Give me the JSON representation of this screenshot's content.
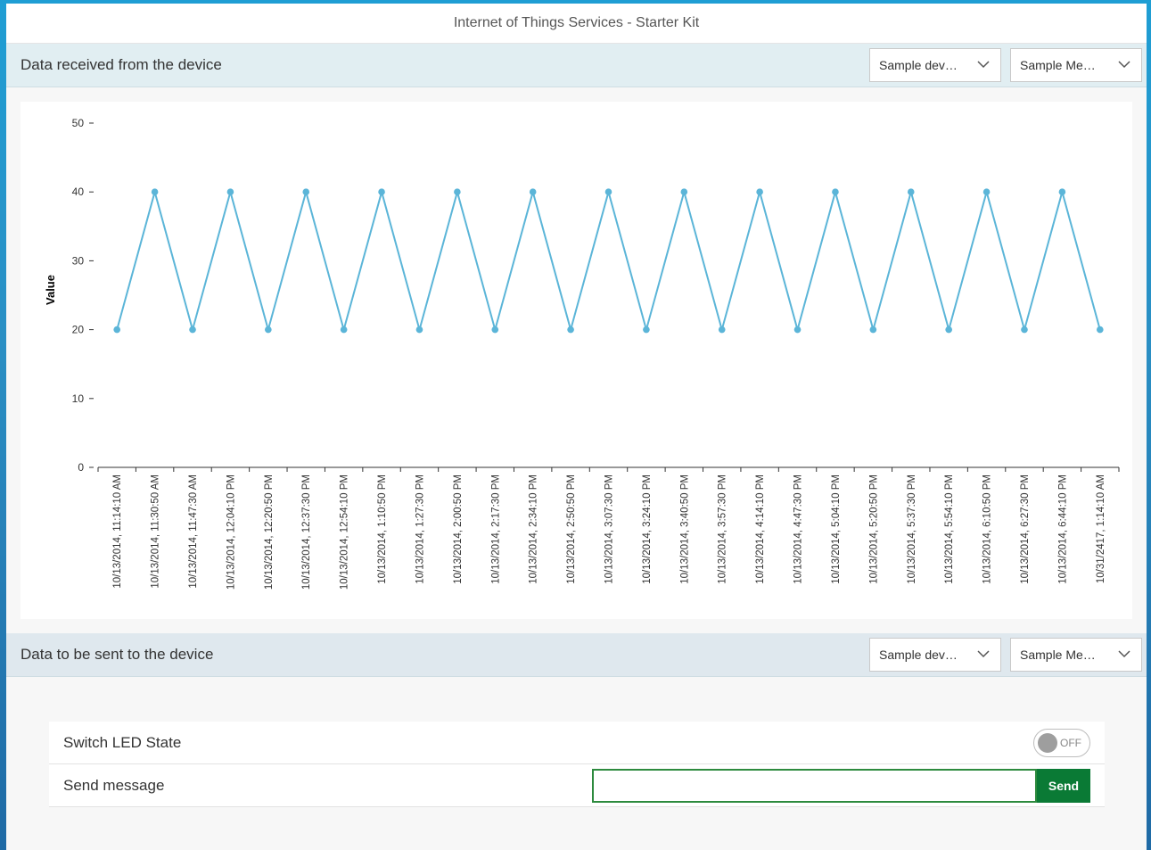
{
  "header": {
    "title": "Internet of Things Services - Starter Kit"
  },
  "received": {
    "title": "Data received from the device",
    "device_select": "Sample dev…",
    "message_select": "Sample Me…"
  },
  "sent": {
    "title": "Data to be sent to the device",
    "device_select": "Sample dev…",
    "message_select": "Sample Me…",
    "switch_label": "Switch LED State",
    "switch_state": "OFF",
    "message_label": "Send message",
    "message_value": "",
    "send_label": "Send"
  },
  "icons": {
    "dropdown": "chevron-down-icon"
  },
  "colors": {
    "line": "#5bb5d8",
    "send_button": "#0a7a35",
    "input_border": "#2d8a3e"
  },
  "chart_data": {
    "type": "line",
    "ylabel": "Value",
    "xlabel": "",
    "ylim": [
      0,
      50
    ],
    "yticks": [
      0,
      10,
      20,
      30,
      40,
      50
    ],
    "grid": false,
    "categories": [
      "10/13/2014, 11:14:10 AM",
      "10/13/2014, 11:30:50 AM",
      "10/13/2014, 11:47:30 AM",
      "10/13/2014, 12:04:10 PM",
      "10/13/2014, 12:20:50 PM",
      "10/13/2014, 12:37:30 PM",
      "10/13/2014, 12:54:10 PM",
      "10/13/2014, 1:10:50 PM",
      "10/13/2014, 1:27:30 PM",
      "10/13/2014, 2:00:50 PM",
      "10/13/2014, 2:17:30 PM",
      "10/13/2014, 2:34:10 PM",
      "10/13/2014, 2:50:50 PM",
      "10/13/2014, 3:07:30 PM",
      "10/13/2014, 3:24:10 PM",
      "10/13/2014, 3:40:50 PM",
      "10/13/2014, 3:57:30 PM",
      "10/13/2014, 4:14:10 PM",
      "10/13/2014, 4:47:30 PM",
      "10/13/2014, 5:04:10 PM",
      "10/13/2014, 5:20:50 PM",
      "10/13/2014, 5:37:30 PM",
      "10/13/2014, 5:54:10 PM",
      "10/13/2014, 6:10:50 PM",
      "10/13/2014, 6:27:30 PM",
      "10/13/2014, 6:44:10 PM",
      "10/31/2417, 1:14:10 AM"
    ],
    "series": [
      {
        "values": [
          20,
          40,
          20,
          40,
          20,
          40,
          20,
          40,
          20,
          40,
          20,
          40,
          20,
          40,
          20,
          40,
          20,
          40,
          20,
          40,
          20,
          40,
          20,
          40,
          20,
          40,
          20
        ]
      }
    ]
  }
}
